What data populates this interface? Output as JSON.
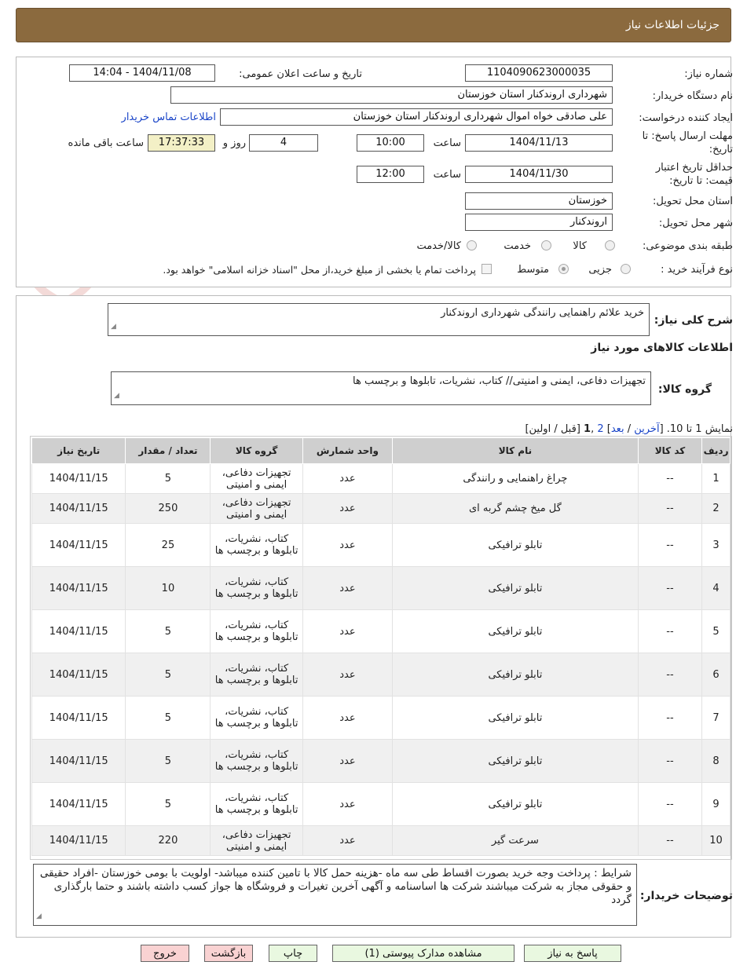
{
  "header": {
    "title": "جزئیات اطلاعات نیاز"
  },
  "watermark": {
    "text": "AriaTender.neT"
  },
  "info": {
    "need_number_label": "شماره نیاز:",
    "need_number": "1104090623000035",
    "announce_label": "تاریخ و ساعت اعلان عمومی:",
    "announce_value": "1404/11/08 - 14:04",
    "buyer_org_label": "نام دستگاه خریدار:",
    "buyer_org": "شهرداری اروندکنار استان خوزستان",
    "creator_label": "ایجاد کننده درخواست:",
    "creator": "علی صادقی خواه اموال شهرداری اروندکنار استان خوزستان",
    "contact_link": "اطلاعات تماس خریدار",
    "deadline_label_1": "مهلت ارسال پاسخ: تا",
    "deadline_label_2": "تاریخ:",
    "deadline_date": "1404/11/13",
    "time_label": "ساعت",
    "deadline_time": "10:00",
    "days_value": "4",
    "days_label": "روز و",
    "remaining_time": "17:37:33",
    "remaining_label": "ساعت باقی مانده",
    "validity_label_1": "حداقل تاریخ اعتبار",
    "validity_label_2": "قیمت: تا تاریخ:",
    "validity_date": "1404/11/30",
    "validity_time": "12:00",
    "province_label": "استان محل تحویل:",
    "province": "خوزستان",
    "city_label": "شهر محل تحویل:",
    "city": "اروندکنار",
    "category_label": "طبقه بندی موضوعی:",
    "category_options": [
      "کالا",
      "خدمت",
      "کالا/خدمت"
    ],
    "process_label": "نوع فرآیند خرید :",
    "process_options": [
      "جزیی",
      "متوسط"
    ],
    "payment_note": "پرداخت تمام یا بخشی از مبلغ خرید،از محل \"اسناد خزانه اسلامی\" خواهد بود."
  },
  "summary": {
    "label": "شرح کلی نیاز:",
    "value": "خرید علائم راهنمایی رانندگی شهرداری اروندکنار",
    "goods_title": "اطلاعات کالاهای مورد نیاز",
    "group_label": "گروه کالا:",
    "group_value": "تجهیزات دفاعی، ایمنی و امنیتی// کتاب، نشریات، تابلوها و برچسب ها"
  },
  "pager": {
    "prefix": "نمایش 1 تا 10. [",
    "last": "آخرین",
    "sep1": " / ",
    "next": "بعد",
    "mid": "] ",
    "page2": "2",
    "comma": " ,",
    "page1": "1",
    "suffix": " [قبل / اولین]"
  },
  "table": {
    "headers": [
      "ردیف",
      "کد کالا",
      "نام کالا",
      "واحد شمارش",
      "گروه کالا",
      "تعداد / مقدار",
      "تاریخ نیاز"
    ],
    "rows": [
      [
        "1",
        "--",
        "چراغ راهنمایی و رانندگی",
        "عدد",
        "تجهیزات دفاعی، ایمنی و امنیتی",
        "5",
        "1404/11/15"
      ],
      [
        "2",
        "--",
        "گل میخ چشم گربه ای",
        "عدد",
        "تجهیزات دفاعی، ایمنی و امنیتی",
        "250",
        "1404/11/15"
      ],
      [
        "3",
        "--",
        "تابلو ترافیکی",
        "عدد",
        "کتاب، نشریات، تابلوها و برچسب ها",
        "25",
        "1404/11/15"
      ],
      [
        "4",
        "--",
        "تابلو ترافیکی",
        "عدد",
        "کتاب، نشریات، تابلوها و برچسب ها",
        "10",
        "1404/11/15"
      ],
      [
        "5",
        "--",
        "تابلو ترافیکی",
        "عدد",
        "کتاب، نشریات، تابلوها و برچسب ها",
        "5",
        "1404/11/15"
      ],
      [
        "6",
        "--",
        "تابلو ترافیکی",
        "عدد",
        "کتاب، نشریات، تابلوها و برچسب ها",
        "5",
        "1404/11/15"
      ],
      [
        "7",
        "--",
        "تابلو ترافیکی",
        "عدد",
        "کتاب، نشریات، تابلوها و برچسب ها",
        "5",
        "1404/11/15"
      ],
      [
        "8",
        "--",
        "تابلو ترافیکی",
        "عدد",
        "کتاب، نشریات، تابلوها و برچسب ها",
        "5",
        "1404/11/15"
      ],
      [
        "9",
        "--",
        "تابلو ترافیکی",
        "عدد",
        "کتاب، نشریات، تابلوها و برچسب ها",
        "5",
        "1404/11/15"
      ],
      [
        "10",
        "--",
        "سرعت گیر",
        "عدد",
        "تجهیزات دفاعی، ایمنی و امنیتی",
        "220",
        "1404/11/15"
      ]
    ]
  },
  "buyer_notes": {
    "label": "توضیحات خریدار:",
    "value": "شرایط : پرداخت وجه خرید بصورت اقساط طی سه ماه -هزینه حمل کالا با تامین کننده میباشد- اولویت با بومی خوزستان -افراد حقیقی و حقوقی مجاز به شرکت میباشند شرکت ها اساسنامه و آگهی آخرین تغیرات و فروشگاه ها جواز کسب داشته باشند و حتما بارگذاری گردد"
  },
  "buttons": {
    "reply": "پاسخ به نیاز",
    "attachments": "مشاهده مدارک پیوستی (1)",
    "print": "چاپ",
    "back": "بازگشت",
    "exit": "خروج"
  },
  "colors": {
    "header_bg": "#8b6a3e",
    "link": "#1a45c8",
    "remaining_bg": "#f3f0c6",
    "button_green": "#e9f8e0",
    "button_pink": "#f9d2d2"
  }
}
